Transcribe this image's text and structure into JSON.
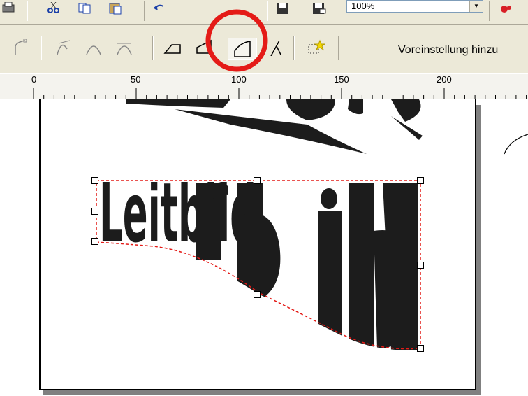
{
  "toolbar_top": {
    "zoom_value": "100%",
    "icons": [
      "print-icon",
      "cut-icon",
      "copy-icon",
      "paste-icon",
      "undo-icon",
      "save-icon",
      "export-icon"
    ]
  },
  "toolbar_shape": {
    "tools": [
      "shape-tool-1",
      "shape-tool-2",
      "shape-tool-3",
      "shape-tool-4",
      "shape-tool-5",
      "shape-tool-6",
      "shape-tool-7",
      "shape-tool-8",
      "preset-tool"
    ],
    "preset_label": "Voreinstellung hinzu"
  },
  "ruler": {
    "labels": [
      "0",
      "50",
      "100",
      "150",
      "200"
    ]
  },
  "canvas": {
    "text_object": "Leitbild"
  },
  "colors": {
    "highlight_circle": "#e41b17",
    "selection_dash": "#e41b17",
    "toolbar_bg": "#ece9d8"
  }
}
